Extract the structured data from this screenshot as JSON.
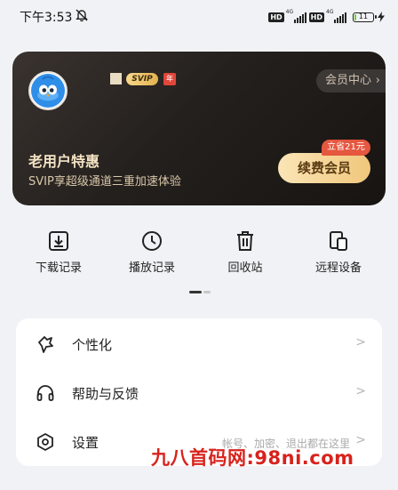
{
  "status_bar": {
    "time": "下午3:53",
    "network_1": "4G",
    "network_2": "4G",
    "hd_1": "HD",
    "hd_2": "HD",
    "battery": "11",
    "battery_level": 0.11
  },
  "vip_card": {
    "badge": "SVIP",
    "year_badge": "年",
    "member_center": "会员中心",
    "offer_title": "老用户特惠",
    "offer_subtitle": "SVIP享超级通道三重加速体验",
    "save_tag": "立省21元",
    "renew_button": "续费会员",
    "colors": {
      "gold": "#f0c77c",
      "card_dark": "#1e1a17",
      "red": "#e5573f"
    }
  },
  "quick_actions": [
    {
      "label": "下载记录",
      "icon": "download-box-icon"
    },
    {
      "label": "播放记录",
      "icon": "clock-icon"
    },
    {
      "label": "回收站",
      "icon": "trash-icon"
    },
    {
      "label": "远程设备",
      "icon": "devices-icon"
    }
  ],
  "settings": [
    {
      "label": "个性化",
      "icon": "personalize-icon",
      "hint": ""
    },
    {
      "label": "帮助与反馈",
      "icon": "headset-icon",
      "hint": ""
    },
    {
      "label": "设置",
      "icon": "settings-hexagon-icon",
      "hint": "帐号、加密、退出都在这里"
    }
  ],
  "watermark": "九八首码网:98ni.com"
}
